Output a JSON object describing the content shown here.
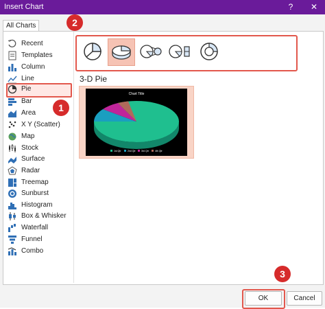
{
  "window": {
    "title": "Insert Chart",
    "help_label": "?",
    "close_label": "✕"
  },
  "tabs": [
    {
      "label": "All Charts"
    }
  ],
  "sidebar": {
    "items": [
      {
        "label": "Recent",
        "icon": "recent-icon"
      },
      {
        "label": "Templates",
        "icon": "templates-icon"
      },
      {
        "label": "Column",
        "icon": "column-chart-icon"
      },
      {
        "label": "Line",
        "icon": "line-chart-icon"
      },
      {
        "label": "Pie",
        "icon": "pie-chart-icon",
        "selected": true
      },
      {
        "label": "Bar",
        "icon": "bar-chart-icon"
      },
      {
        "label": "Area",
        "icon": "area-chart-icon"
      },
      {
        "label": "X Y (Scatter)",
        "icon": "scatter-chart-icon"
      },
      {
        "label": "Map",
        "icon": "map-chart-icon"
      },
      {
        "label": "Stock",
        "icon": "stock-chart-icon"
      },
      {
        "label": "Surface",
        "icon": "surface-chart-icon"
      },
      {
        "label": "Radar",
        "icon": "radar-chart-icon"
      },
      {
        "label": "Treemap",
        "icon": "treemap-chart-icon"
      },
      {
        "label": "Sunburst",
        "icon": "sunburst-chart-icon"
      },
      {
        "label": "Histogram",
        "icon": "histogram-chart-icon"
      },
      {
        "label": "Box & Whisker",
        "icon": "box-whisker-chart-icon"
      },
      {
        "label": "Waterfall",
        "icon": "waterfall-chart-icon"
      },
      {
        "label": "Funnel",
        "icon": "funnel-chart-icon"
      },
      {
        "label": "Combo",
        "icon": "combo-chart-icon"
      }
    ]
  },
  "subtypes": [
    {
      "icon": "pie-icon",
      "selected": false
    },
    {
      "icon": "3d-pie-icon",
      "selected": true
    },
    {
      "icon": "pie-of-pie-icon",
      "selected": false
    },
    {
      "icon": "bar-of-pie-icon",
      "selected": false
    },
    {
      "icon": "doughnut-icon",
      "selected": false
    }
  ],
  "section_title": "3-D Pie",
  "preview": {
    "chart_title": "Chart Title",
    "legend": [
      "1st Qtr",
      "2nd Qtr",
      "3rd Qtr",
      "4th Qtr"
    ],
    "colors": [
      "#1fbf8f",
      "#1a9fc0",
      "#c0259a",
      "#b06a5a"
    ]
  },
  "badges": [
    "1",
    "2",
    "3"
  ],
  "footer": {
    "ok_label": "OK",
    "cancel_label": "Cancel"
  },
  "colors": {
    "titlebar": "#6a1b9a",
    "highlight": "#e2574c",
    "badge": "#d62b2b",
    "selected_subtype": "#f6c3b4"
  }
}
